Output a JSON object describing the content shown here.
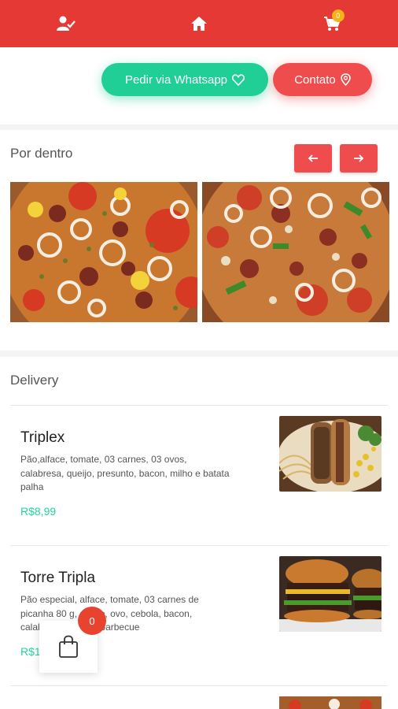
{
  "topbar": {
    "icons": [
      "user-check-icon",
      "home-icon",
      "cart-icon"
    ],
    "cart_count": "0",
    "color": "#e53935"
  },
  "hero": {
    "whatsapp_label": "Pedir via Whatsapp",
    "whatsapp_icon": "heart-icon",
    "contact_label": "Contato",
    "contact_icon": "map-pin-icon"
  },
  "gallery": {
    "title": "Por dentro",
    "prev_icon": "arrow-left-icon",
    "next_icon": "arrow-right-icon",
    "photos": [
      "pizza-photo-1",
      "pizza-photo-2"
    ]
  },
  "delivery": {
    "title": "Delivery",
    "items": [
      {
        "name": "Triplex",
        "description": "Pão,alface, tomate, 03 carnes, 03 ovos, calabresa, queijo, presunto, bacon, milho e batata palha",
        "price": "R$8,99"
      },
      {
        "name": "Torre Tripla",
        "description": "Pão especial, alface, tomate, 03 carnes de picanha 80 g, queijo, ovo, cebola, bacon, calabresa e molho barbecue",
        "price": "R$1"
      }
    ]
  },
  "bag": {
    "count": "0",
    "icon": "shopping-bag-icon"
  },
  "colors": {
    "accent_red": "#ef4d4d",
    "whatsapp_green": "#1fcf95",
    "price_green": "#20d69c"
  }
}
